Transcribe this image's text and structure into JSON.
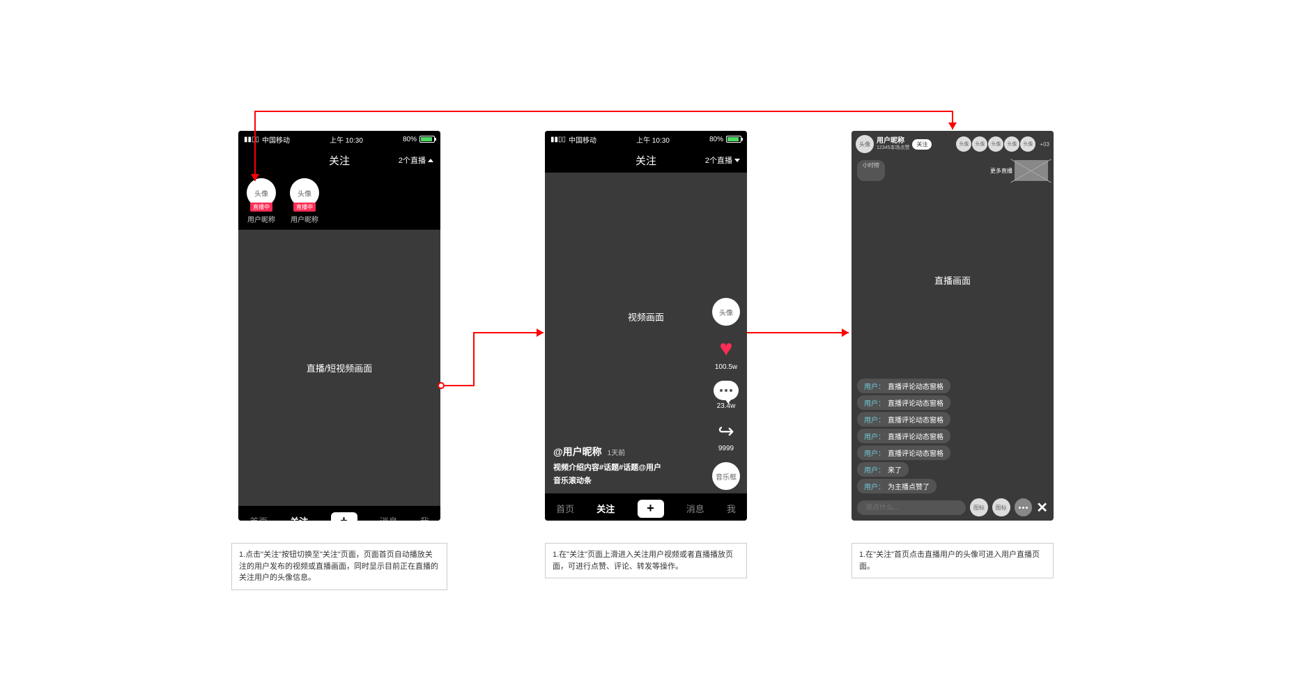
{
  "status": {
    "carrier": "中国移动",
    "time": "上午 10:30",
    "battery": "80%"
  },
  "phone1": {
    "nav_title": "关注",
    "live_count": "2个直播",
    "avatars": [
      {
        "label": "头像",
        "badge": "直播中",
        "name": "用户昵称"
      },
      {
        "label": "头像",
        "badge": "直播中",
        "name": "用户昵称"
      }
    ],
    "video_label": "直播/短视频画面"
  },
  "phone2": {
    "nav_title": "关注",
    "live_count": "2个直播",
    "video_label": "视频画面",
    "avatar_label": "头像",
    "like_count": "100.5w",
    "comment_count": "23.4w",
    "share_count": "9999",
    "music_label": "音乐框",
    "username": "@用户昵称",
    "time_ago": "1天前",
    "caption": "视频介绍内容#话题#话题@用户",
    "music_text": "音乐滚动条"
  },
  "phone3": {
    "host_avatar": "头像",
    "host_name": "用户昵称",
    "host_sub": "12345本场点赞",
    "follow_btn": "关注",
    "viewer_label": "头像",
    "viewer_count": "+03",
    "leaderboard": "小时榜",
    "more_live": "更多直播",
    "live_label": "直播画面",
    "comments": [
      {
        "user": "用户：",
        "text": "直播评论动态窗格"
      },
      {
        "user": "用户：",
        "text": "直播评论动态窗格"
      },
      {
        "user": "用户：",
        "text": "直播评论动态窗格"
      },
      {
        "user": "用户：",
        "text": "直播评论动态窗格"
      },
      {
        "user": "用户：",
        "text": "直播评论动态窗格"
      },
      {
        "user": "用户：",
        "text": "来了"
      },
      {
        "user": "用户：",
        "text": "为主播点赞了"
      }
    ],
    "input_placeholder": "说点什么...",
    "icon_label": "图标"
  },
  "tabs": {
    "home": "首页",
    "follow": "关注",
    "message": "消息",
    "me": "我"
  },
  "annotations": {
    "a1": "1.点击\"关注\"按钮切换至\"关注\"页面，页面首页自动播放关注的用户发布的视频或直播画面，同时显示目前正在直播的关注用户的头像信息。",
    "a2": "1.在\"关注\"页面上滑进入关注用户视频或者直播播放页面，可进行点赞、评论、转发等操作。",
    "a3": "1.在\"关注\"首页点击直播用户的头像可进入用户直播页面。"
  }
}
